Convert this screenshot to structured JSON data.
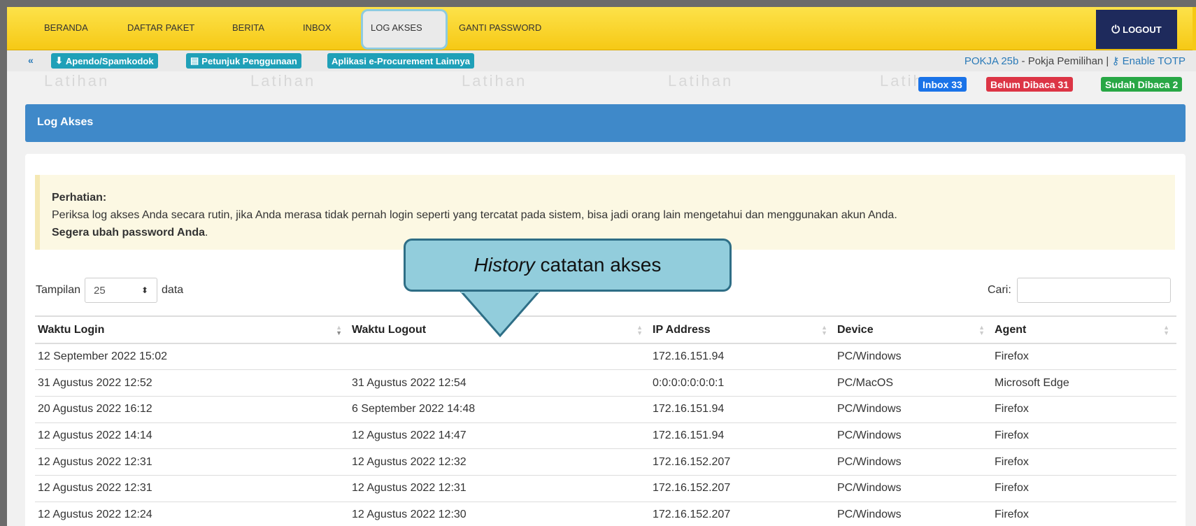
{
  "nav": {
    "items": [
      "BERANDA",
      "DAFTAR PAKET",
      "BERITA",
      "INBOX",
      "LOG AKSES",
      "GANTI PASSWORD"
    ],
    "logout": "LOGOUT"
  },
  "subbar": {
    "buttons": [
      "Apendo/Spamkodok",
      "Petunjuk Penggunaan",
      "Aplikasi e-Procurement Lainnya"
    ],
    "user_group": "POKJA 25b",
    "user_role": " - Pokja Pemilihan | ",
    "totp": "Enable TOTP"
  },
  "watermark": "Latihan",
  "badges": {
    "inbox": "Inbox 33",
    "unread": "Belum Dibaca 31",
    "read": "Sudah Dibaca 2"
  },
  "panel": {
    "title": "Log Akses"
  },
  "alert": {
    "title": "Perhatian:",
    "body": "Periksa log akses Anda secara rutin, jika Anda merasa tidak pernah login seperti yang tercatat pada sistem, bisa jadi orang lain mengetahui dan menggunakan akun Anda.",
    "strong": "Segera ubah password Anda",
    "end": "."
  },
  "controls": {
    "show_label": "Tampilan",
    "page_size": "25",
    "data_label": "data",
    "search_label": "Cari:"
  },
  "table": {
    "headers": [
      "Waktu Login",
      "Waktu Logout",
      "IP Address",
      "Device",
      "Agent"
    ],
    "rows": [
      [
        "12 September 2022 15:02",
        "",
        "172.16.151.94",
        "PC/Windows",
        "Firefox"
      ],
      [
        "31 Agustus 2022 12:52",
        "31 Agustus 2022 12:54",
        "0:0:0:0:0:0:0:1",
        "PC/MacOS",
        "Microsoft Edge"
      ],
      [
        "20 Agustus 2022 16:12",
        "6 September 2022 14:48",
        "172.16.151.94",
        "PC/Windows",
        "Firefox"
      ],
      [
        "12 Agustus 2022 14:14",
        "12 Agustus 2022 14:47",
        "172.16.151.94",
        "PC/Windows",
        "Firefox"
      ],
      [
        "12 Agustus 2022 12:31",
        "12 Agustus 2022 12:32",
        "172.16.152.207",
        "PC/Windows",
        "Firefox"
      ],
      [
        "12 Agustus 2022 12:31",
        "12 Agustus 2022 12:31",
        "172.16.152.207",
        "PC/Windows",
        "Firefox"
      ],
      [
        "12 Agustus 2022 12:24",
        "12 Agustus 2022 12:30",
        "172.16.152.207",
        "PC/Windows",
        "Firefox"
      ]
    ]
  },
  "callout": {
    "italic": "History",
    "rest": " catatan akses"
  },
  "colors": {
    "nav_bg": "#f6c915",
    "logout_bg": "#1e2a5c",
    "panel_head": "#3f89c9",
    "badge_inbox": "#1a73e8",
    "badge_unread": "#dc3545",
    "badge_read": "#28a745",
    "callout": "#92cddc"
  }
}
